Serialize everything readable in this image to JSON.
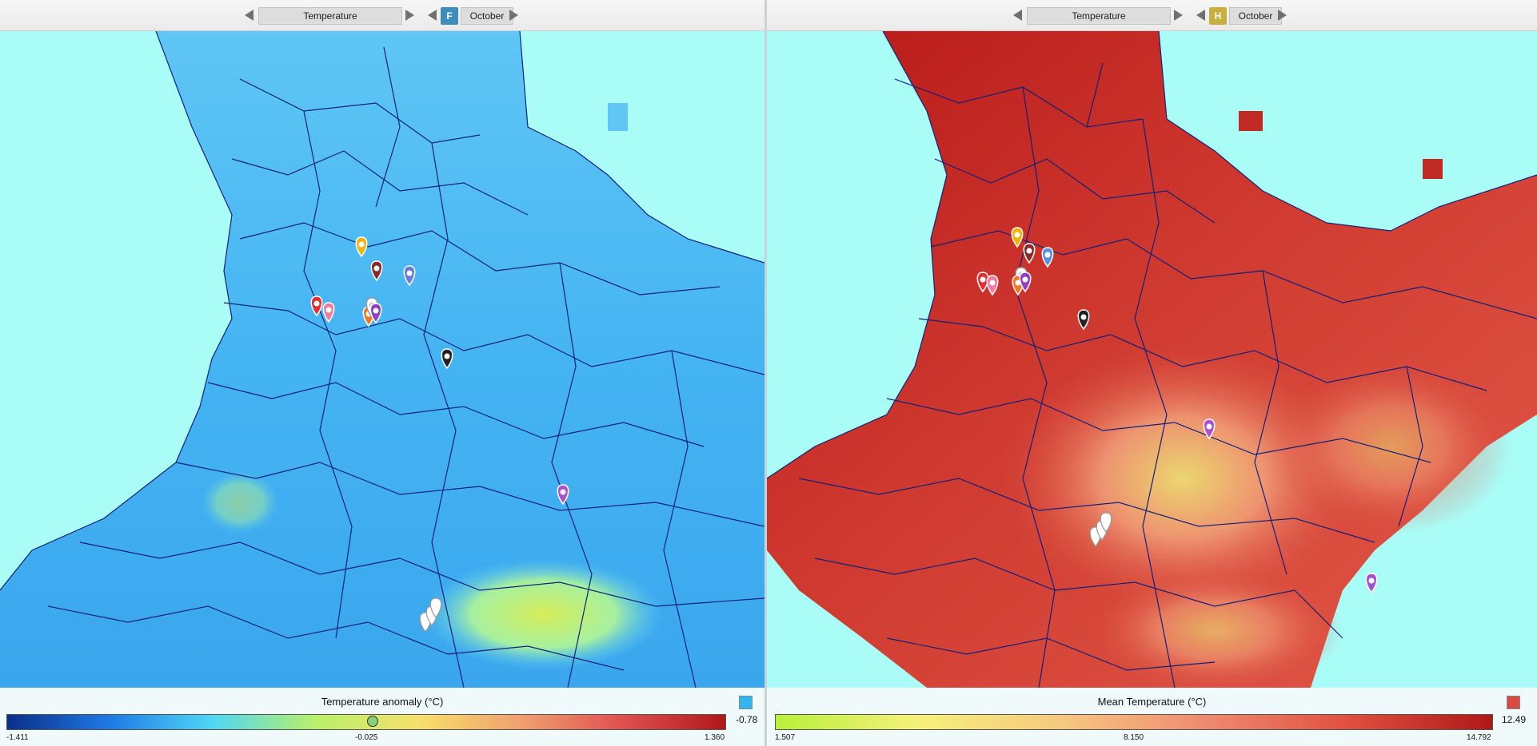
{
  "left_panel": {
    "variable": "Temperature",
    "scenario_letter": "F",
    "scenario_color": "#3c8dbc",
    "month": "October",
    "legend": {
      "title": "Temperature anomaly (°C)",
      "value": "-0.78",
      "swatch_color": "#33b5f0",
      "min_label": "-1.411",
      "mid_label": "-0.025",
      "max_label": "1.360",
      "min": -1.411,
      "mid": -0.025,
      "max": 1.36,
      "marker_value": 0.0,
      "gradient_colors": [
        "#0a2f8a",
        "#1e7ae6",
        "#4fd6f5",
        "#b8f06a",
        "#f6e06a",
        "#f0a070",
        "#e05050",
        "#b01818"
      ]
    },
    "markers": [
      {
        "name": "marker-orange-yellow",
        "color": "#f0b400"
      },
      {
        "name": "marker-dark-red",
        "color": "#8b2a2a"
      },
      {
        "name": "marker-periwinkle",
        "color": "#6a7ad8"
      },
      {
        "name": "marker-red",
        "color": "#e03030"
      },
      {
        "name": "marker-pink",
        "color": "#f07aa0"
      },
      {
        "name": "marker-orange",
        "color": "#f07820"
      },
      {
        "name": "marker-white",
        "color": "#ffffff"
      },
      {
        "name": "marker-purple",
        "color": "#9040c0"
      },
      {
        "name": "marker-black",
        "color": "#222222"
      },
      {
        "name": "marker-magenta",
        "color": "#b050d0"
      },
      {
        "name": "marker-white-cluster",
        "color": "#ffffff"
      }
    ]
  },
  "right_panel": {
    "variable": "Temperature",
    "scenario_letter": "H",
    "scenario_color": "#c8b040",
    "month": "October",
    "legend": {
      "title": "Mean Temperature (°C)",
      "value": "12.49",
      "swatch_color": "#d94a40",
      "min_label": "1.507",
      "mid_label": "8.150",
      "max_label": "14.792",
      "min": 1.507,
      "mid": 8.15,
      "max": 14.792,
      "gradient_colors": [
        "#b8f03a",
        "#f6f07a",
        "#f6c880",
        "#ef8a70",
        "#e05040",
        "#b01818"
      ]
    },
    "markers": [
      {
        "name": "marker-orange-yellow",
        "color": "#f0b400"
      },
      {
        "name": "marker-dark-red",
        "color": "#8b2a2a"
      },
      {
        "name": "marker-blue",
        "color": "#5a8ee0"
      },
      {
        "name": "marker-red",
        "color": "#e03030"
      },
      {
        "name": "marker-pink",
        "color": "#f07aa0"
      },
      {
        "name": "marker-white",
        "color": "#ffffff"
      },
      {
        "name": "marker-orange",
        "color": "#f07820"
      },
      {
        "name": "marker-purple",
        "color": "#9040c0"
      },
      {
        "name": "marker-black",
        "color": "#222222"
      },
      {
        "name": "marker-magenta",
        "color": "#b050d0"
      },
      {
        "name": "marker-white-cluster",
        "color": "#ffffff"
      },
      {
        "name": "marker-violet",
        "color": "#a050d0"
      }
    ]
  },
  "colors": {
    "sea": "#aafcf6",
    "boundary": "#10207a"
  }
}
